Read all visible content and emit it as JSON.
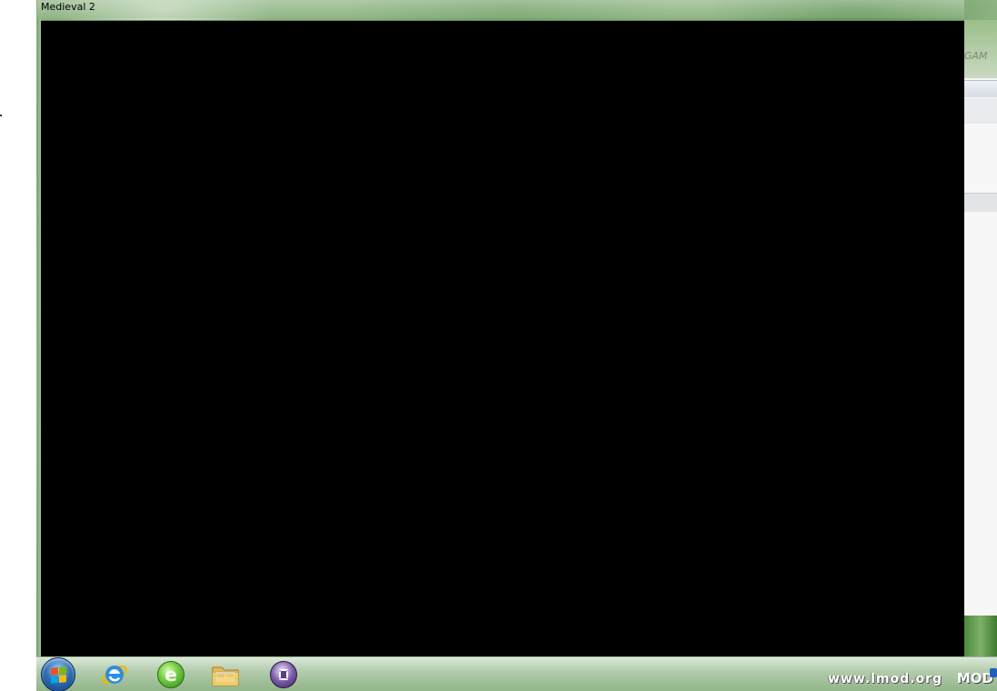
{
  "window": {
    "title": "Medieval 2"
  },
  "background_window": {
    "header_text": "GAM"
  },
  "taskbar": {
    "items": [
      {
        "name": "start-button",
        "icon": "windows-logo-icon"
      },
      {
        "name": "internet-explorer",
        "icon": "internet-explorer-icon"
      },
      {
        "name": "browser-360",
        "icon": "green-e-browser-icon",
        "glyph": "e"
      },
      {
        "name": "file-explorer",
        "icon": "folder-icon"
      },
      {
        "name": "media-player",
        "icon": "media-player-icon"
      }
    ],
    "watermark": "www.lmod.org",
    "watermark_mod": "MOD"
  },
  "colors": {
    "client_area": "#000000",
    "wallpaper": "#7ea873",
    "taskbar": "#bcd4b6"
  }
}
